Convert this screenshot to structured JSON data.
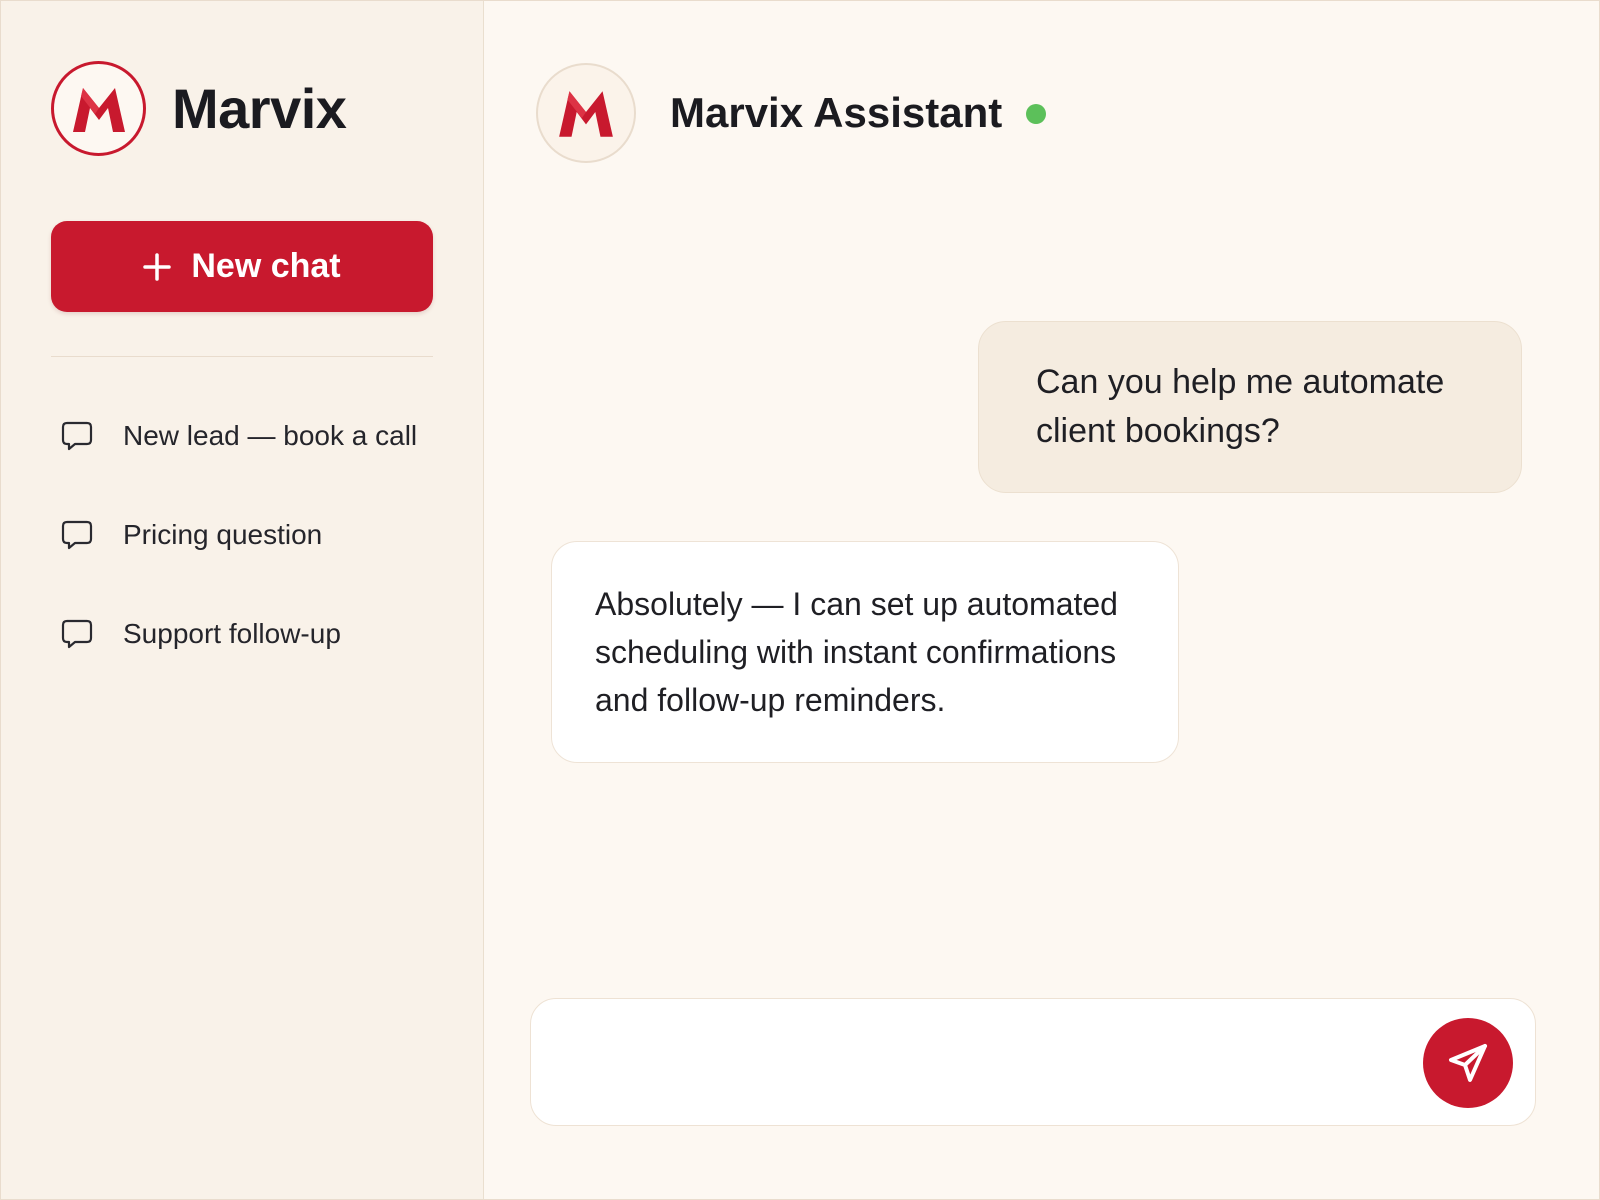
{
  "brand": {
    "name": "Marvix",
    "logo_letter": "M",
    "accent_color": "#c8192e"
  },
  "sidebar": {
    "new_chat_label": "New chat",
    "new_chat_icon": "plus-icon",
    "history": [
      {
        "label": "New lead — book a call",
        "icon": "chat-bubble-icon"
      },
      {
        "label": "Pricing question",
        "icon": "chat-bubble-icon"
      },
      {
        "label": "Support follow-up",
        "icon": "chat-bubble-icon"
      }
    ]
  },
  "header": {
    "assistant_name": "Marvix Assistant",
    "status": "online",
    "status_color": "#5cc05a"
  },
  "messages": [
    {
      "role": "user",
      "text": "Can you help me automate client bookings?"
    },
    {
      "role": "assistant",
      "text": "Absolutely — I can set up automated scheduling with instant confirmations and follow-up reminders."
    }
  ],
  "composer": {
    "value": "",
    "placeholder": "",
    "send_icon": "send-icon"
  }
}
